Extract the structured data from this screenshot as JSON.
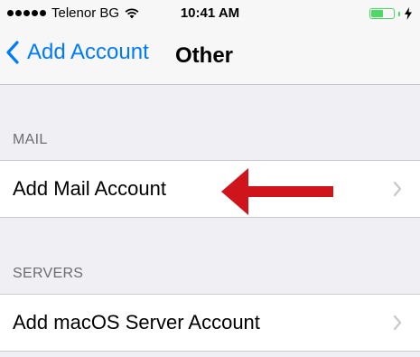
{
  "status_bar": {
    "carrier": "Telenor BG",
    "time": "10:41 AM",
    "signal_icon": "signal-dots-icon",
    "wifi_icon": "wifi-icon",
    "battery_icon": "battery-icon",
    "charging_icon": "charging-bolt-icon",
    "battery_level": 0.55,
    "battery_color": "#4cd964"
  },
  "nav_bar": {
    "back_label": "Add Account",
    "title": "Other",
    "back_icon": "chevron-left-icon",
    "accent_color": "#007aff"
  },
  "sections": [
    {
      "header": "MAIL",
      "items": [
        {
          "label": "Add Mail Account",
          "icon": "chevron-right-icon"
        }
      ]
    },
    {
      "header": "SERVERS",
      "items": [
        {
          "label": "Add macOS Server Account",
          "icon": "chevron-right-icon"
        }
      ]
    }
  ],
  "annotation": {
    "icon": "red-arrow-icon",
    "color": "#d0141c"
  }
}
